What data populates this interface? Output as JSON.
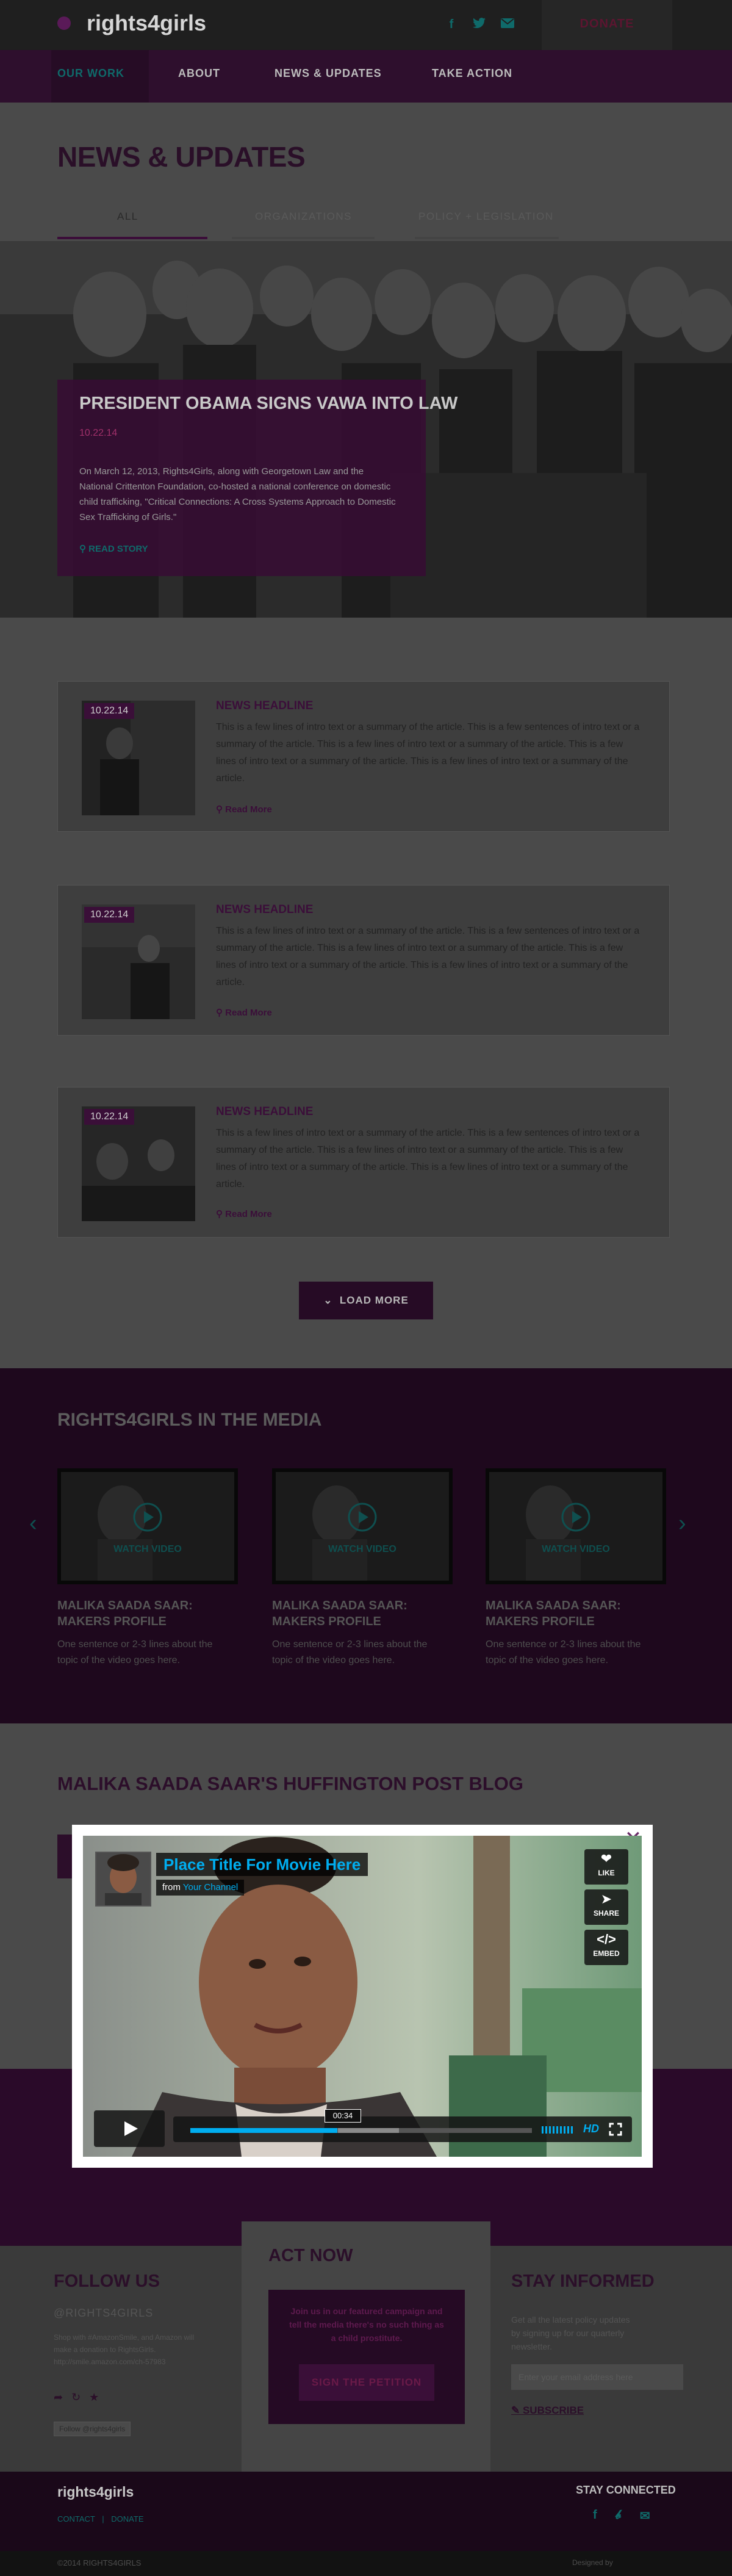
{
  "header": {
    "logo": "rights4girls",
    "social_icons": [
      "facebook-icon",
      "twitter-icon",
      "email-icon"
    ],
    "donate_label": "DONATE"
  },
  "nav": {
    "items": [
      "OUR WORK",
      "ABOUT",
      "NEWS & UPDATES",
      "TAKE ACTION"
    ]
  },
  "news": {
    "title": "NEWS & UPDATES",
    "tabs": [
      "ALL",
      "ORGANIZATIONS",
      "POLICY + LEGISLATION"
    ],
    "hero": {
      "title": "PRESIDENT OBAMA SIGNS VAWA INTO LAW",
      "date": "10.22.14",
      "text": "On March 12, 2013, Rights4Girls, along with Georgetown Law and the National Crittenton Foundation, co-hosted a national conference on domestic child trafficking, \"Critical Connections: A Cross Systems Approach to Domestic Sex Trafficking of Girls.\"",
      "read_label": "READ STORY"
    },
    "cards": [
      {
        "date": "10.22.14",
        "headline": "NEWS HEADLINE",
        "text": "This is a few lines of intro text or a summary of the article. This is a few sentences of intro text or a summary of the article. This is a few lines of intro text or a summary of the article. This is a few lines of intro text or a summary of the article. This is a few lines of intro text or a summary of the article.",
        "more": "Read More"
      },
      {
        "date": "10.22.14",
        "headline": "NEWS HEADLINE",
        "text": "This is a few lines of intro text or a summary of the article. This is a few sentences of intro text or a summary of the article. This is a few lines of intro text or a summary of the article. This is a few lines of intro text or a summary of the article. This is a few lines of intro text or a summary of the article.",
        "more": "Read More"
      },
      {
        "date": "10.22.14",
        "headline": "NEWS HEADLINE",
        "text": "This is a few lines of intro text or a summary of the article. This is a few sentences of intro text or a summary of the article. This is a few lines of intro text or a summary of the article. This is a few lines of intro text or a summary of the article. This is a few lines of intro text or a summary of the article.",
        "more": "Read More"
      }
    ],
    "load_more": "LOAD MORE"
  },
  "media": {
    "title": "RIGHTS4GIRLS IN THE MEDIA",
    "videos": [
      {
        "label": "WATCH VIDEO",
        "title1": "MALIKA SAADA SAAR:",
        "title2": "MAKERS PROFILE",
        "desc": "One sentence or 2-3 lines about the topic of the video goes here."
      },
      {
        "label": "WATCH VIDEO",
        "title1": "MALIKA SAADA SAAR:",
        "title2": "MAKERS PROFILE",
        "desc": "One sentence or 2-3 lines about the topic of the video goes here."
      },
      {
        "label": "WATCH VIDEO",
        "title1": "MALIKA SAADA SAAR:",
        "title2": "MAKERS PROFILE",
        "desc": "One sentence or 2-3 lines about the topic of the video goes here."
      }
    ]
  },
  "huffpost": {
    "title": "MALIKA SAADA SAAR'S HUFFINGTON POST BLOG"
  },
  "footer": {
    "follow_title": "FOLLOW US",
    "handle": "@RIGHTS4GIRLS",
    "tweet": "Shop with #AmazonSmile, and Amazon will make a donation to RightsGirls. http://smile.amazon.com/ch-57983",
    "follow_button": "Follow @rights4girls",
    "act_title": "ACT NOW",
    "act_text": "Join us in our featured campaign and tell the media there's no such thing as a child prostitute.",
    "petition": "SIGN THE PETITION",
    "stay_title": "STAY INFORMED",
    "stay_text": "Get all the latest policy updates by signing up for our quarterly newsletter.",
    "email_placeholder": "Enter your email address here",
    "subscribe": "SUBSCRIBE",
    "bottom_logo": "rights4girls",
    "contact": "CONTACT",
    "donate": "DONATE",
    "stay_connected": "STAY CONNECTED",
    "copyright": "©2014 RIGHTS4GIRLS",
    "credit": "Designed by"
  },
  "modal": {
    "title": "Place Title For Movie Here",
    "from": "from",
    "channel": "Your Channel",
    "like": "LIKE",
    "share": "SHARE",
    "embed": "EMBED",
    "time": "00:34",
    "progress": 0.43,
    "hd": "HD"
  }
}
